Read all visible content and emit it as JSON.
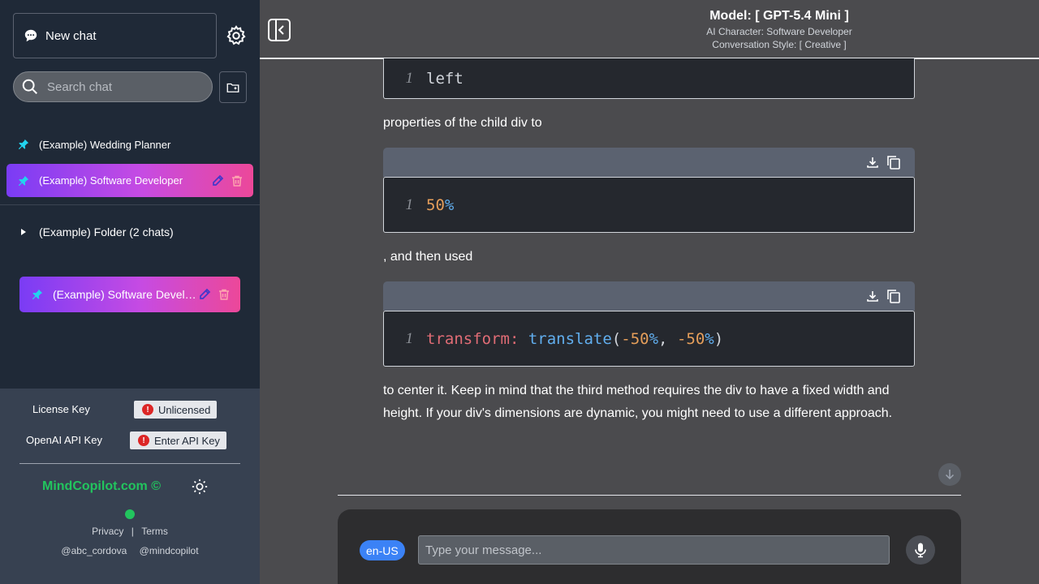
{
  "sidebar": {
    "new_chat_label": "New chat",
    "search_placeholder": "Search chat",
    "chats": [
      {
        "label": "(Example) Wedding Planner",
        "pinned": true
      },
      {
        "label": "(Example) Software Developer",
        "pinned": true,
        "active": true
      }
    ],
    "folder": {
      "label": "(Example) Folder (2 chats)",
      "expanded": false
    },
    "folder_chat": {
      "label": "(Example) Software Developer",
      "pinned": true
    },
    "license_label": "License Key",
    "license_status": "Unlicensed",
    "api_label": "OpenAI API Key",
    "api_button": "Enter API Key",
    "brand": "MindCopilot.com ©",
    "privacy": "Privacy",
    "separator": "|",
    "terms": "Terms",
    "handle1": "@abc_cordova",
    "handle2": "@mindcopilot"
  },
  "header": {
    "model": "Model: [ GPT-5.4 Mini ]",
    "character": "AI Character: Software Developer",
    "style": "Conversation Style: [ Creative ]"
  },
  "conversation": {
    "code1": {
      "line": "1",
      "text": "left"
    },
    "para1": "properties of the child div to",
    "code2": {
      "line": "1",
      "num": "50",
      "pct": "%"
    },
    "para2": ", and then used",
    "code3": {
      "line": "1",
      "kw": "transform:",
      "fn": "translate",
      "open": "(",
      "minus1": "-",
      "num1": "50",
      "pct1": "%",
      "comma": ", ",
      "minus2": "-",
      "num2": "50",
      "pct2": "%",
      "close": ")"
    },
    "para3": "to center it. Keep in mind that the third method requires the div to have a fixed width and height. If your div's dimensions are dynamic, you might need to use a different approach."
  },
  "input": {
    "language": "en-US",
    "placeholder": "Type your message..."
  },
  "colors": {
    "accent_gradient_start": "#7a3cf5",
    "accent_gradient_end": "#ec4899",
    "brand_green": "#22c55e",
    "language_badge": "#3b82f6",
    "error_red": "#dc2626"
  },
  "icons": [
    "chat-bubble-icon",
    "gear-icon",
    "search-icon",
    "new-folder-icon",
    "pin-icon",
    "edit-icon",
    "trash-icon",
    "chevron-right-icon",
    "sun-icon",
    "sidebar-toggle-icon",
    "download-icon",
    "copy-icon",
    "arrow-down-icon",
    "microphone-icon"
  ]
}
